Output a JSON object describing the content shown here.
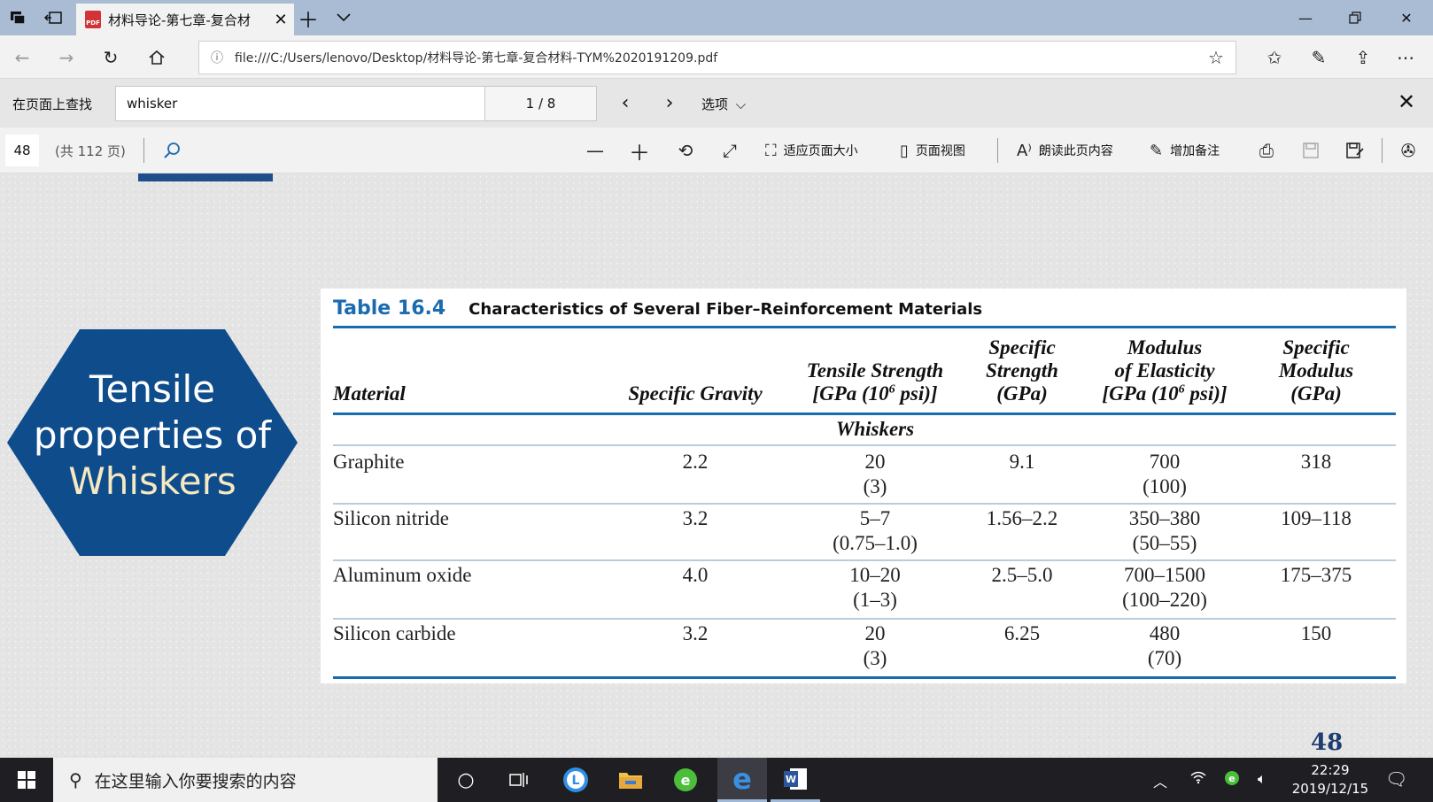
{
  "browser": {
    "tab_title": "材料导论-第七章-复合材",
    "pdf_badge": "PDF",
    "url": "file:///C:/Users/lenovo/Desktop/材料导论-第七章-复合材料-TYM%2020191209.pdf"
  },
  "find_bar": {
    "label": "在页面上查找",
    "query": "whisker",
    "match_count": "1 / 8",
    "options_label": "选项"
  },
  "pdf_toolbar": {
    "page_number": "48",
    "page_total": "(共 112 页)",
    "fit_page_label": "适应页面大小",
    "page_view_label": "页面视图",
    "read_aloud_label": "朗读此页内容",
    "add_notes_label": "增加备注"
  },
  "slide": {
    "hex_lines": [
      "Tensile",
      "properties of",
      "Whiskers"
    ],
    "page_number": "48",
    "table": {
      "number": "Table 16.4",
      "title": "Characteristics of Several Fiber–Reinforcement Materials",
      "headers": {
        "material": "Material",
        "specific_gravity": "Specific Gravity",
        "tensile_1": "Tensile Strength",
        "tensile_2a": "[GPa (10",
        "tensile_sup": "6",
        "tensile_2b": " psi)]",
        "spec_strength_1": "Specific",
        "spec_strength_2": "Strength",
        "spec_strength_3": "(GPa)",
        "modulus_1": "Modulus",
        "modulus_2": "of Elasticity",
        "modulus_3a": "[GPa (10",
        "modulus_sup": "6",
        "modulus_3b": " psi)]",
        "spec_modulus_1": "Specific",
        "spec_modulus_2": "Modulus",
        "spec_modulus_3": "(GPa)"
      },
      "section": "Whiskers",
      "rows": [
        {
          "material": "Graphite",
          "gravity": "2.2",
          "tensile": "20",
          "tensile_psi": "(3)",
          "spec_strength": "9.1",
          "modulus": "700",
          "modulus_psi": "(100)",
          "spec_modulus": "318"
        },
        {
          "material": "Silicon nitride",
          "gravity": "3.2",
          "tensile": "5–7",
          "tensile_psi": "(0.75–1.0)",
          "spec_strength": "1.56–2.2",
          "modulus": "350–380",
          "modulus_psi": "(50–55)",
          "spec_modulus": "109–118"
        },
        {
          "material": "Aluminum oxide",
          "gravity": "4.0",
          "tensile": "10–20",
          "tensile_psi": "(1–3)",
          "spec_strength": "2.5–5.0",
          "modulus": "700–1500",
          "modulus_psi": "(100–220)",
          "spec_modulus": "175–375"
        },
        {
          "material": "Silicon carbide",
          "gravity": "3.2",
          "tensile": "20",
          "tensile_psi": "(3)",
          "spec_strength": "6.25",
          "modulus": "480",
          "modulus_psi": "(70)",
          "spec_modulus": "150"
        }
      ]
    }
  },
  "taskbar": {
    "search_placeholder": "在这里输入你要搜索的内容",
    "time": "22:29",
    "date": "2019/12/15"
  },
  "colors": {
    "hexagon": "#0f4c8c",
    "table_accent": "#1a6bb0",
    "title_bar": "#a9bcd4"
  }
}
